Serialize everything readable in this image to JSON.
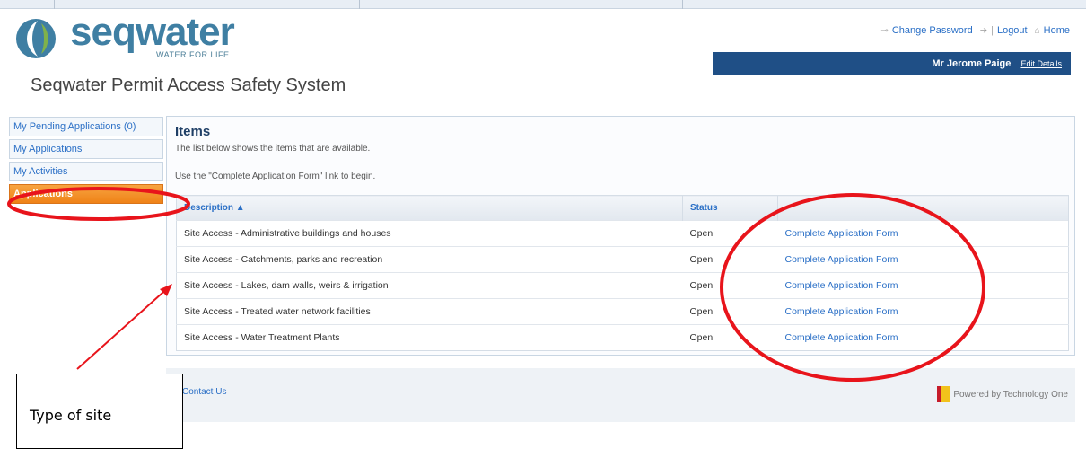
{
  "brand": {
    "logo_word": "seqwater",
    "tagline": "WATER FOR LIFE",
    "app_title": "Seqwater Permit Access Safety System"
  },
  "top_links": {
    "change_password": "Change Password",
    "logout": "Logout",
    "home": "Home"
  },
  "user": {
    "name": "Mr Jerome Paige",
    "edit_label": "Edit Details"
  },
  "sidebar": {
    "items": [
      {
        "label": "My Pending Applications (0)"
      },
      {
        "label": "My Applications"
      },
      {
        "label": "My Activities"
      },
      {
        "label": "Applications"
      }
    ]
  },
  "main": {
    "title": "Items",
    "desc1": "The list below shows the items that are available.",
    "desc2": "Use the \"Complete Application Form\" link to begin.",
    "columns": {
      "description": "Description ▲",
      "status": "Status",
      "action": ""
    },
    "rows": [
      {
        "description": "Site Access - Administrative buildings and houses",
        "status": "Open",
        "action": "Complete Application Form"
      },
      {
        "description": "Site Access - Catchments, parks and recreation",
        "status": "Open",
        "action": "Complete Application Form"
      },
      {
        "description": "Site Access - Lakes, dam walls, weirs & irrigation",
        "status": "Open",
        "action": "Complete Application Form"
      },
      {
        "description": "Site Access - Treated water network facilities",
        "status": "Open",
        "action": "Complete Application Form"
      },
      {
        "description": "Site Access - Water Treatment Plants",
        "status": "Open",
        "action": "Complete Application Form"
      }
    ]
  },
  "footer": {
    "contact": "Contact Us",
    "powered": "Powered by Technology One"
  },
  "annotation": {
    "callout": "Type of site",
    "color": "#e8141b"
  }
}
